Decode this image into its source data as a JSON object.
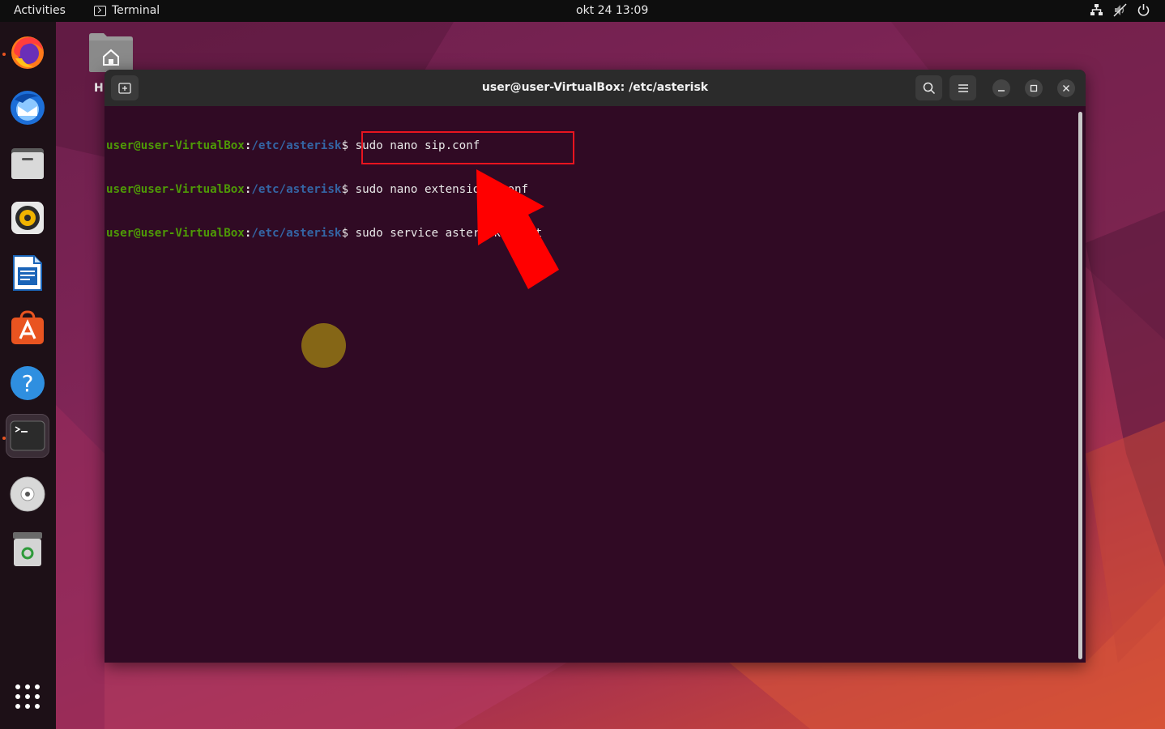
{
  "topbar": {
    "activities": "Activities",
    "app_name": "Terminal",
    "clock": "okt 24  13:09",
    "tray_icons": [
      "network-icon",
      "volume-muted-icon",
      "power-icon"
    ]
  },
  "dock": {
    "items": [
      {
        "name": "firefox",
        "icon": "firefox-icon",
        "running": true
      },
      {
        "name": "thunderbird",
        "icon": "thunderbird-icon",
        "running": false
      },
      {
        "name": "files",
        "icon": "files-icon",
        "running": false
      },
      {
        "name": "rhythmbox",
        "icon": "rhythmbox-icon",
        "running": false
      },
      {
        "name": "libreoffice-writer",
        "icon": "writer-icon",
        "running": false
      },
      {
        "name": "ubuntu-software",
        "icon": "software-icon",
        "running": false
      },
      {
        "name": "help",
        "icon": "help-icon",
        "running": false
      },
      {
        "name": "terminal",
        "icon": "terminal-icon",
        "running": true,
        "active": true
      },
      {
        "name": "optical-drive",
        "icon": "disc-icon",
        "running": false
      },
      {
        "name": "trash",
        "icon": "trash-icon",
        "running": false
      },
      {
        "name": "show-apps",
        "icon": "app-grid-icon",
        "running": false
      }
    ]
  },
  "desktop": {
    "home_label": "H"
  },
  "terminal": {
    "title": "user@user-VirtualBox: /etc/asterisk",
    "lines": [
      {
        "user": "user@user-VirtualBox",
        "colon": ":",
        "path": "/etc/asterisk",
        "dollar": "$",
        "command": " sudo nano sip.conf"
      },
      {
        "user": "user@user-VirtualBox",
        "colon": ":",
        "path": "/etc/asterisk",
        "dollar": "$",
        "command": " sudo nano extensions.conf"
      },
      {
        "user": "user@user-VirtualBox",
        "colon": ":",
        "path": "/etc/asterisk",
        "dollar": "$",
        "command": " sudo service asterisk start"
      }
    ]
  },
  "colors": {
    "terminal_bg": "#300a24",
    "prompt_user": "#4e9a06",
    "prompt_path": "#3465a4",
    "highlight": "#e8141f",
    "accent": "#e95420"
  }
}
